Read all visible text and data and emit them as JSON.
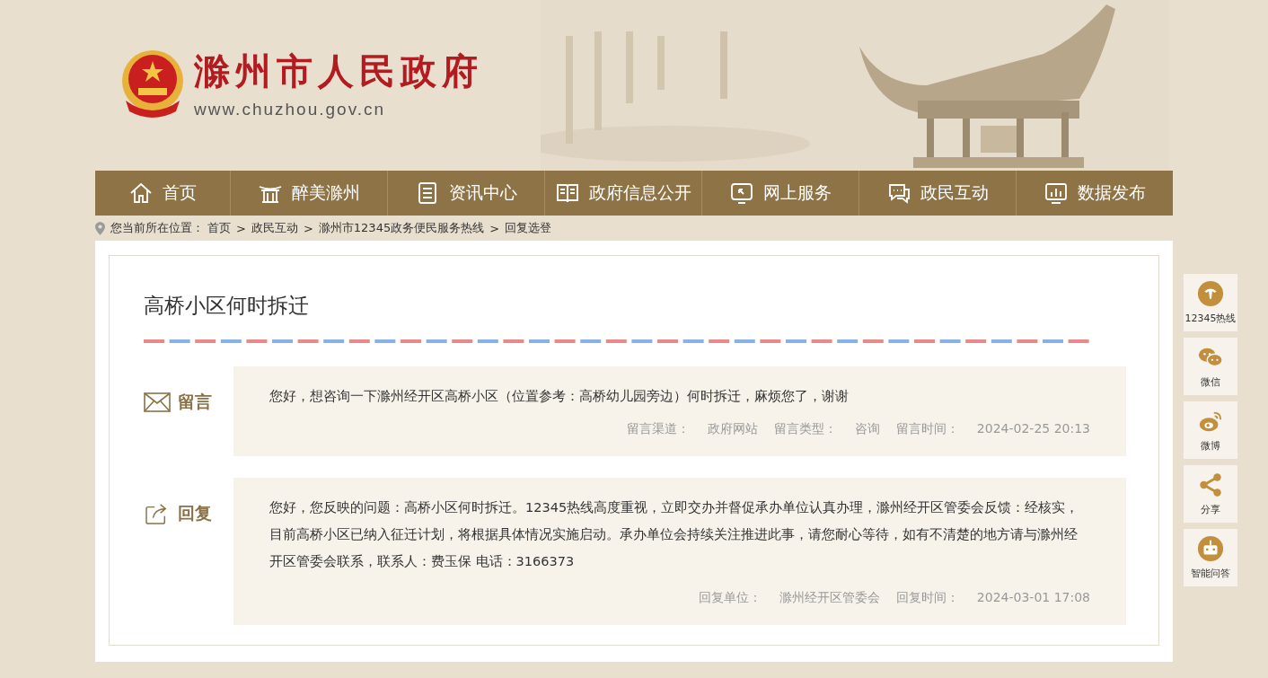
{
  "header": {
    "title": "滁州市人民政府",
    "url": "www.chuzhou.gov.cn"
  },
  "nav": [
    {
      "label": "首页",
      "kind": "home"
    },
    {
      "label": "醉美滁州",
      "kind": "pavilion"
    },
    {
      "label": "资讯中心",
      "kind": "document"
    },
    {
      "label": "政府信息公开",
      "kind": "book"
    },
    {
      "label": "网上服务",
      "kind": "monitor"
    },
    {
      "label": "政民互动",
      "kind": "chat"
    },
    {
      "label": "数据发布",
      "kind": "chart"
    }
  ],
  "breadcrumb": {
    "prefix": "您当前所在位置：",
    "separator": ">",
    "items": [
      "首页",
      "政民互动",
      "滁州市12345政务便民服务热线",
      "回复选登"
    ]
  },
  "article": {
    "title": "高桥小区何时拆迁",
    "entries": [
      {
        "kind": "message",
        "label": "留言",
        "body": "您好，想咨询一下滁州经开区高桥小区（位置参考：高桥幼儿园旁边）何时拆迁，麻烦您了，谢谢",
        "meta": [
          {
            "label": "留言渠道：",
            "value": "政府网站"
          },
          {
            "label": "留言类型：",
            "value": "咨询"
          },
          {
            "label": "留言时间：",
            "value": "2024-02-25 20:13"
          }
        ]
      },
      {
        "kind": "reply",
        "label": "回复",
        "body": "您好，您反映的问题：高桥小区何时拆迁。12345热线高度重视，立即交办并督促承办单位认真办理，滁州经开区管委会反馈：经核实，目前高桥小区已纳入征迁计划，将根据具体情况实施启动。承办单位会持续关注推进此事，请您耐心等待，如有不清楚的地方请与滁州经开区管委会联系，联系人：费玉保 电话：3166373",
        "meta": [
          {
            "label": "回复单位：",
            "value": "滁州经开区管委会"
          },
          {
            "label": "回复时间：",
            "value": "2024-03-01 17:08"
          }
        ]
      }
    ]
  },
  "side": [
    {
      "label": "12345热线",
      "kind": "hotline"
    },
    {
      "label": "微信",
      "kind": "wechat"
    },
    {
      "label": "微博",
      "kind": "weibo"
    },
    {
      "label": "分享",
      "kind": "share"
    },
    {
      "label": "智能问答",
      "kind": "robot"
    }
  ]
}
